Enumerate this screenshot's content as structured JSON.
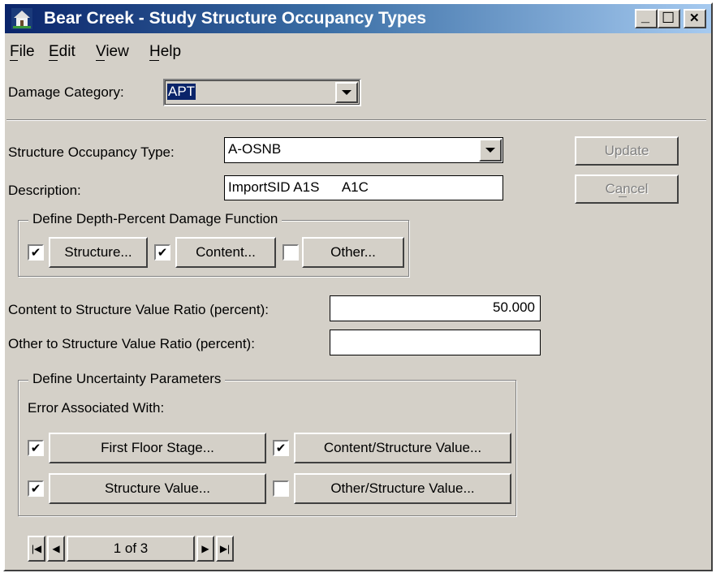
{
  "window": {
    "title": "Bear Creek - Study Structure Occupancy Types",
    "controls": {
      "minimize": "_",
      "maximize": "☐",
      "close": "✕"
    }
  },
  "menu": {
    "file": "File",
    "edit": "Edit",
    "view": "View",
    "help": "Help"
  },
  "damage_category": {
    "label": "Damage Category:",
    "value": "APT"
  },
  "occupancy": {
    "label": "Structure Occupancy Type:",
    "value": "A-OSNB"
  },
  "description": {
    "label": "Description:",
    "value": "ImportSID A1S      A1C"
  },
  "buttons": {
    "update": "Update",
    "cancel": "Cancel"
  },
  "depth_damage": {
    "legend": "Define Depth-Percent Damage Function",
    "structure": {
      "label": "Structure...",
      "checked": true
    },
    "content": {
      "label": "Content...",
      "checked": true
    },
    "other": {
      "label": "Other...",
      "checked": false
    }
  },
  "ratios": {
    "content_label": "Content to Structure Value Ratio (percent):",
    "content_value": "50.000",
    "other_label": "Other to Structure Value Ratio (percent):",
    "other_value": ""
  },
  "uncertainty": {
    "legend": "Define Uncertainty Parameters",
    "subtitle": "Error Associated With:",
    "first_floor": {
      "label": "First Floor Stage...",
      "checked": true
    },
    "content_structure": {
      "label": "Content/Structure Value...",
      "checked": true
    },
    "structure_value": {
      "label": "Structure Value...",
      "checked": true
    },
    "other_structure": {
      "label": "Other/Structure Value...",
      "checked": false
    }
  },
  "navigation": {
    "record": "1 of 3"
  },
  "colors": {
    "face": "#d4d0c8",
    "title_start": "#0a246a",
    "title_end": "#a6caf0",
    "selection": "#0a246a"
  }
}
